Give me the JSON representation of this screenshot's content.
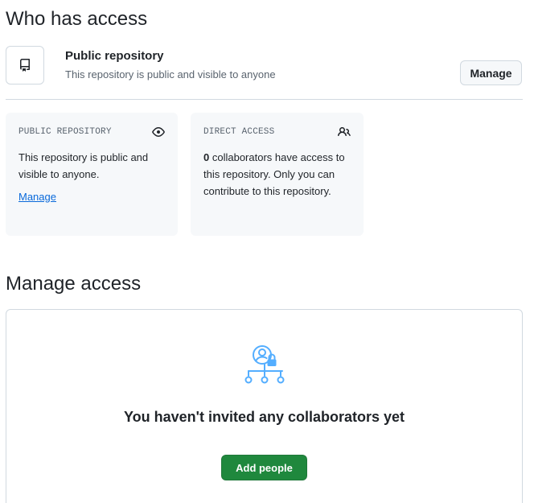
{
  "who_has_access": {
    "title": "Who has access",
    "visibility": {
      "title": "Public repository",
      "description": "This repository is public and visible to anyone",
      "manage_button": "Manage",
      "icon": "repo-icon"
    },
    "cards": {
      "public": {
        "label": "PUBLIC REPOSITORY",
        "icon": "eye-icon",
        "body": "This repository is public and visible to anyone.",
        "link": "Manage"
      },
      "direct": {
        "label": "DIRECT ACCESS",
        "icon": "people-icon",
        "count": "0",
        "body": " collaborators have access to this repository. Only you can contribute to this repository."
      }
    }
  },
  "manage_access": {
    "title": "Manage access",
    "empty_state": {
      "icon": "collaborators-lock-icon",
      "message": "You haven't invited any collaborators yet",
      "add_button": "Add people"
    }
  },
  "colors": {
    "primary_button": "#1f883d",
    "link": "#0969da",
    "empty_icon": "#54aeff",
    "border": "#d1d9e0",
    "card_bg": "#f6f8fa"
  }
}
